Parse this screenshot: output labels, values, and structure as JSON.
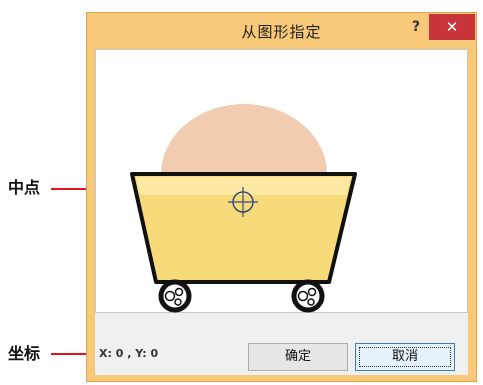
{
  "callouts": {
    "center_label": "中点",
    "coord_label": "坐标"
  },
  "dialog": {
    "title": "从图形指定",
    "help_label": "?",
    "close_label": "✕",
    "coordinate_readout": "X: 0 , Y: 0",
    "ok_label": "确定",
    "cancel_label": "取消"
  },
  "colors": {
    "accent_callout": "#e0141e",
    "cart_fill": "#f7da7a",
    "cart_fill_light": "#fbe9a4",
    "cart_backdrop": "#f2ccb0",
    "title_bar": "#f8c979",
    "close_button": "#c9343a"
  },
  "icons": {
    "crosshair": "crosshair-icon",
    "close": "close-icon",
    "help": "help-icon"
  }
}
